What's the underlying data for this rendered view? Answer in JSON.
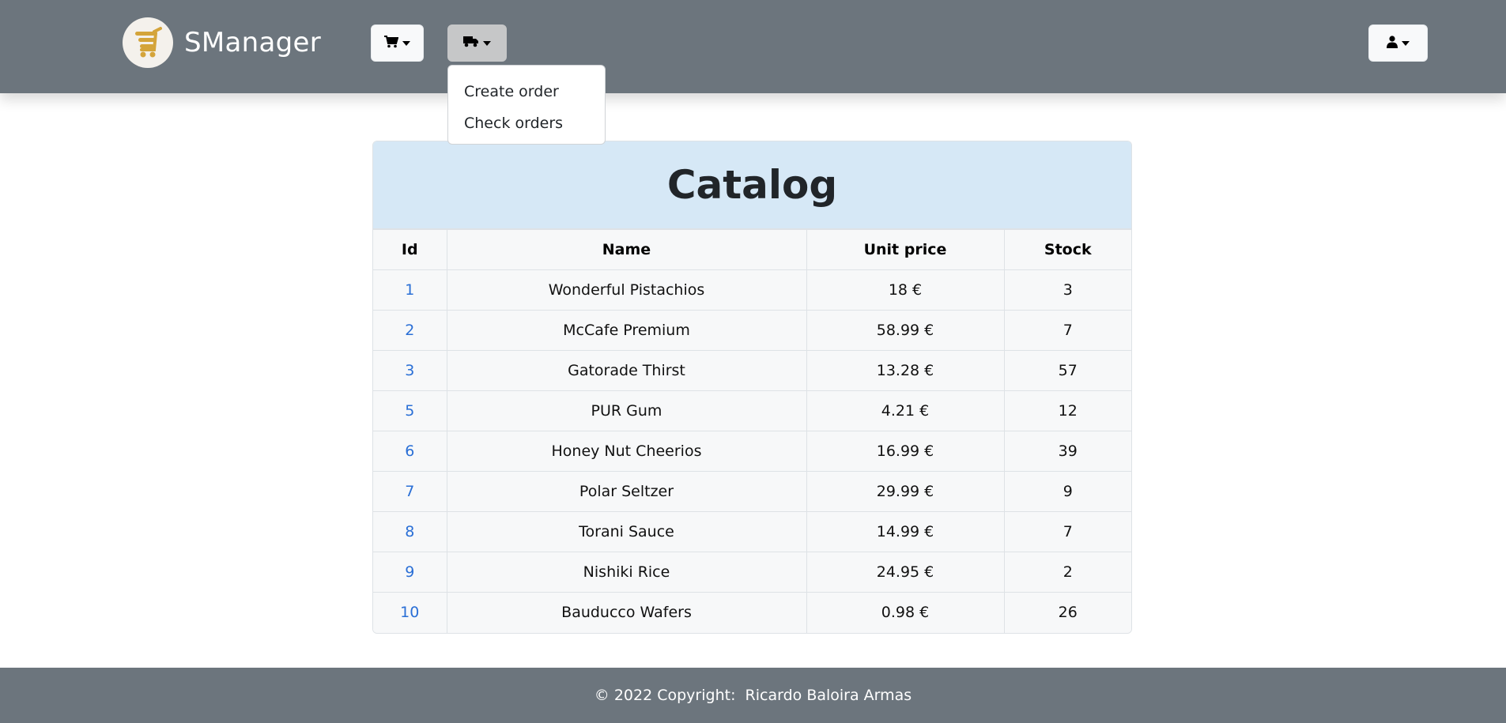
{
  "brand": {
    "name": "SManager",
    "logo_icon": "shopping-cart-logo",
    "logo_color": "#d4a43a"
  },
  "nav": {
    "cart_menu_icon": "shopping-cart-icon",
    "orders_menu_icon": "truck-icon",
    "user_menu_icon": "user-icon",
    "orders_dropdown": {
      "open": true,
      "items": [
        "Create order",
        "Check orders"
      ]
    }
  },
  "catalog": {
    "title": "Catalog",
    "columns": [
      "Id",
      "Name",
      "Unit price",
      "Stock"
    ],
    "rows": [
      {
        "id": "1",
        "name": "Wonderful Pistachios",
        "price": "18 €",
        "stock": "3"
      },
      {
        "id": "2",
        "name": "McCafe Premium",
        "price": "58.99 €",
        "stock": "7"
      },
      {
        "id": "3",
        "name": "Gatorade Thirst",
        "price": "13.28 €",
        "stock": "57"
      },
      {
        "id": "5",
        "name": "PUR Gum",
        "price": "4.21 €",
        "stock": "12"
      },
      {
        "id": "6",
        "name": "Honey Nut Cheerios",
        "price": "16.99 €",
        "stock": "39"
      },
      {
        "id": "7",
        "name": "Polar Seltzer",
        "price": "29.99 €",
        "stock": "9"
      },
      {
        "id": "8",
        "name": "Torani Sauce",
        "price": "14.99 €",
        "stock": "7"
      },
      {
        "id": "9",
        "name": "Nishiki Rice",
        "price": "24.95 €",
        "stock": "2"
      },
      {
        "id": "10",
        "name": "Bauducco Wafers",
        "price": "0.98 €",
        "stock": "26"
      }
    ]
  },
  "footer": {
    "text": "© 2022 Copyright:  Ricardo Baloira Armas"
  },
  "colors": {
    "navbar": "#6c757d",
    "catalog_header": "#d6e8f6",
    "link": "#2a6fd6"
  }
}
